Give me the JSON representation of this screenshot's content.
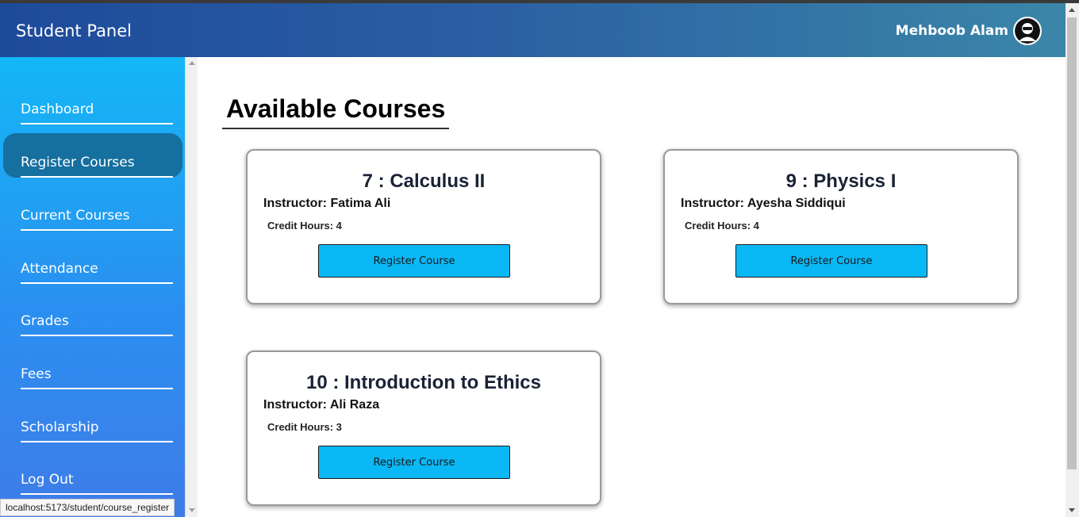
{
  "header": {
    "brand": "Student Panel",
    "user_name": "Mehboob Alam",
    "avatar_icon": "user-avatar-icon"
  },
  "sidebar": {
    "items": [
      {
        "label": "Dashboard"
      },
      {
        "label": "Register Courses",
        "active": true
      },
      {
        "label": "Current Courses"
      },
      {
        "label": "Attendance"
      },
      {
        "label": "Grades"
      },
      {
        "label": "Fees"
      },
      {
        "label": "Scholarship"
      },
      {
        "label": "Log Out"
      }
    ]
  },
  "main": {
    "title": "Available Courses",
    "courses": [
      {
        "title": "7 : Calculus II",
        "instructor": "Instructor: Fatima Ali",
        "credits": "Credit Hours: 4",
        "button": "Register Course"
      },
      {
        "title": "9 : Physics I",
        "instructor": "Instructor: Ayesha Siddiqui",
        "credits": "Credit Hours: 4",
        "button": "Register Course"
      },
      {
        "title": "10 : Introduction to Ethics",
        "instructor": "Instructor: Ali Raza",
        "credits": "Credit Hours: 3",
        "button": "Register Course"
      }
    ]
  },
  "status_bar": {
    "url": "localhost:5173/student/course_register"
  },
  "colors": {
    "accent_button": "#0ab8f5",
    "active_nav": "#156f9f"
  }
}
